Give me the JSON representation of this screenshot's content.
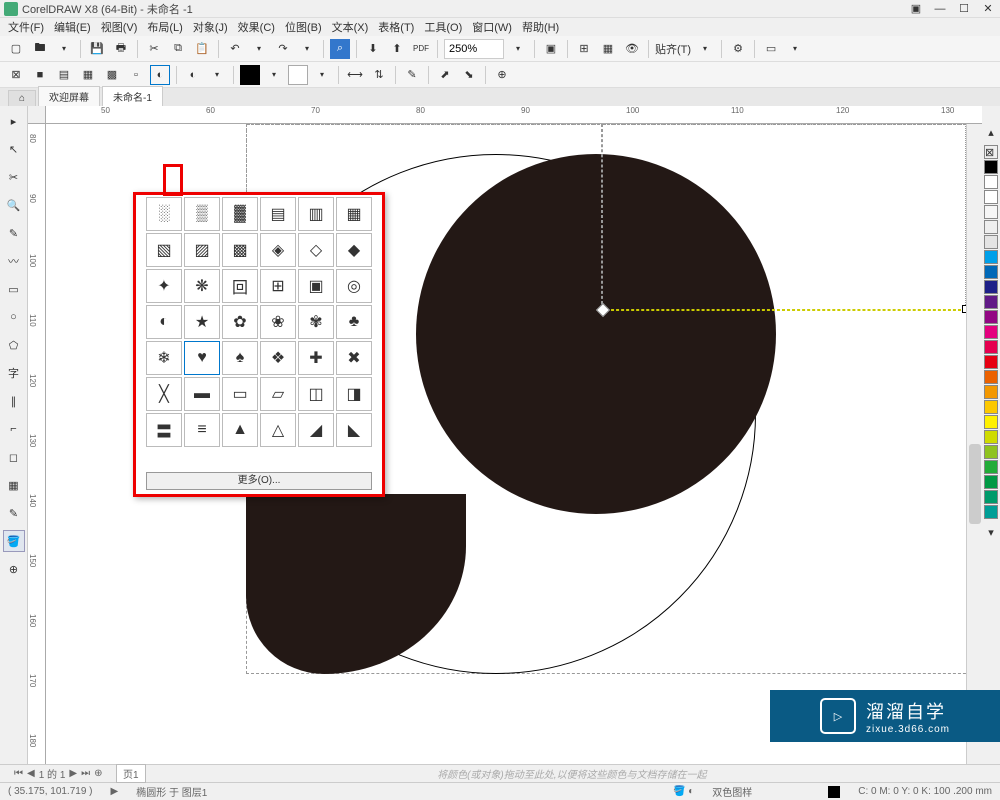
{
  "title": "CorelDRAW X8 (64-Bit) - 未命名 -1",
  "menus": [
    "文件(F)",
    "编辑(E)",
    "视图(V)",
    "布局(L)",
    "对象(J)",
    "效果(C)",
    "位图(B)",
    "文本(X)",
    "表格(T)",
    "工具(O)",
    "窗口(W)",
    "帮助(H)"
  ],
  "toolbar": {
    "zoom": "250%",
    "paste_label": "贴齐(T)"
  },
  "tabs": {
    "welcome": "欢迎屏幕",
    "doc": "未命名-1"
  },
  "ruler_h": [
    "50",
    "60",
    "70",
    "80",
    "90",
    "100",
    "110",
    "120",
    "130"
  ],
  "ruler_v": [
    "80",
    "90",
    "100",
    "110",
    "120",
    "130",
    "140",
    "150",
    "160",
    "170",
    "180"
  ],
  "popup": {
    "more": "更多(O)..."
  },
  "page_nav": {
    "label": "1  的 1",
    "page": "页1"
  },
  "status": {
    "coords": "( 35.175, 101.719 )",
    "arrow": "▶",
    "selection": "椭圆形 于 图层1",
    "hint": "将颜色(或对象)拖动至此处,以便将这些颜色与文档存储在一起",
    "fill_mode": "双色图样",
    "stroke_info": "C: 0 M: 0 Y: 0 K: 100  .200 mm"
  },
  "colors": [
    "#ffffff",
    "#ffffff",
    "#000000",
    "#333333",
    "#666666",
    "#999999",
    "#cccccc",
    "#e0e0e0",
    "#ffffff",
    "#8b0000",
    "#d2691e",
    "#ffd700",
    "#9acd32",
    "#008000",
    "#00ced1",
    "#1e90ff",
    "#0000cd",
    "#4b0082",
    "#800080",
    "#ff1493"
  ],
  "watermark": {
    "main": "溜溜自学",
    "sub": "zixue.3d66.com"
  }
}
